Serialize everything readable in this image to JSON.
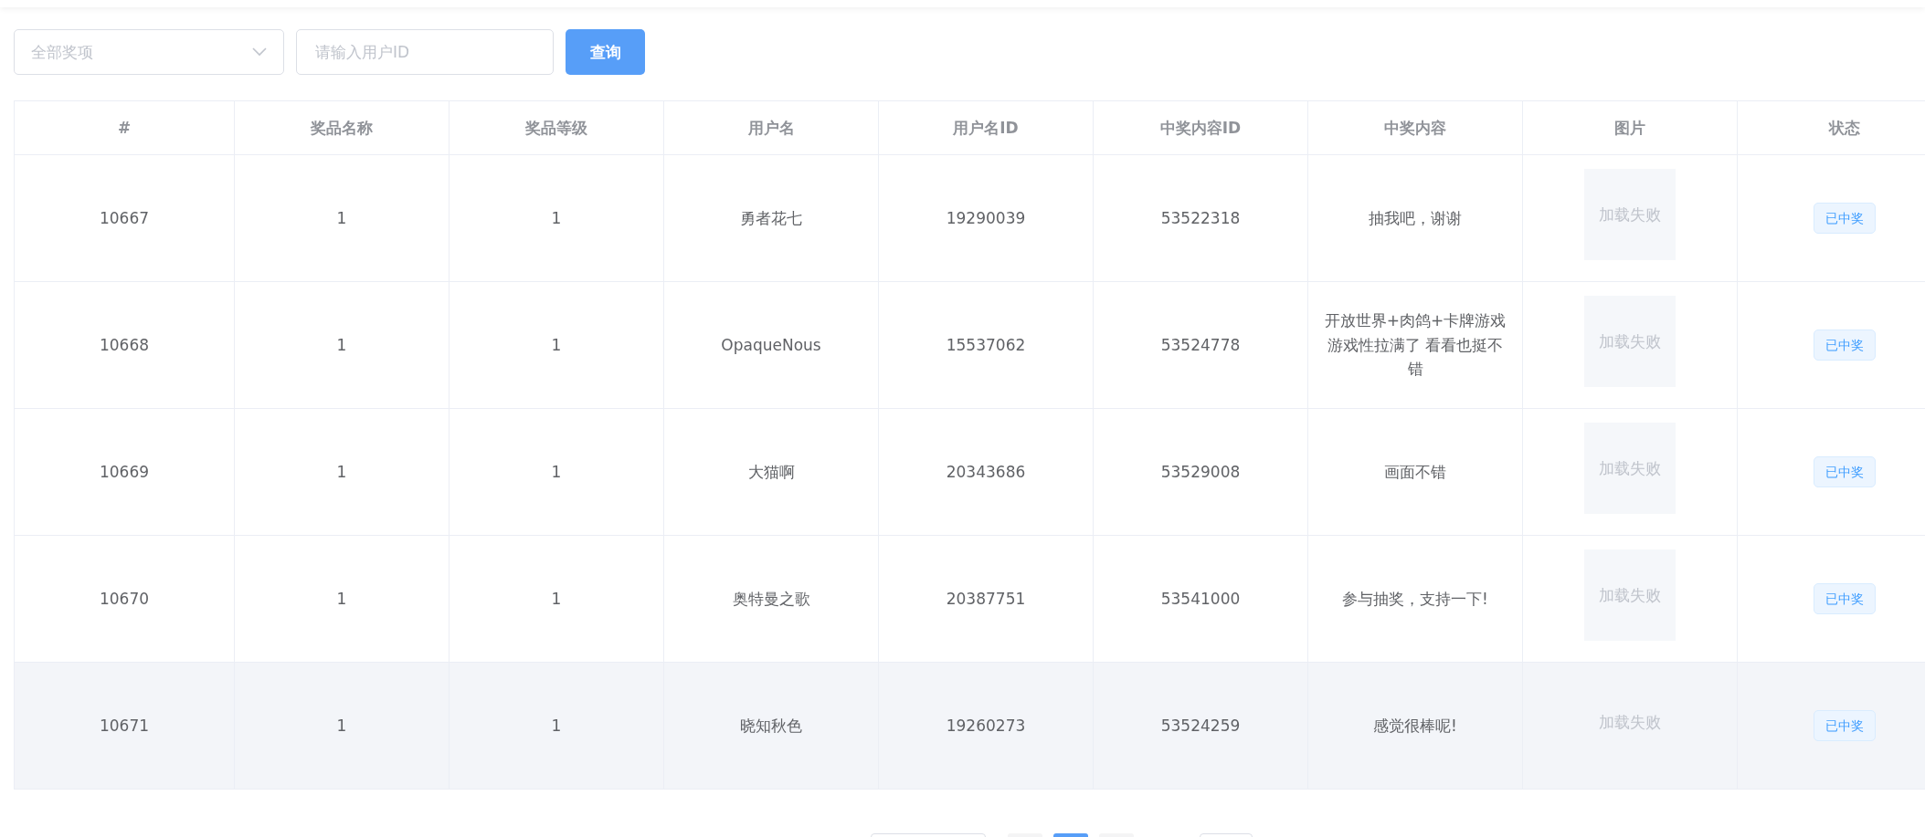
{
  "filters": {
    "prize_select": {
      "placeholder": "全部奖项"
    },
    "user_id": {
      "placeholder": "请输入用户ID"
    },
    "search_button": "查询"
  },
  "table": {
    "columns": [
      "#",
      "奖品名称",
      "奖品等级",
      "用户名",
      "用户名ID",
      "中奖内容ID",
      "中奖内容",
      "图片",
      "状态"
    ],
    "rows": [
      {
        "id": "10667",
        "prize_name": "1",
        "prize_level": "1",
        "username": "勇者花七",
        "user_id": "19290039",
        "content_id": "53522318",
        "content": "抽我吧，谢谢",
        "image": "加载失败",
        "status": "已中奖",
        "highlighted": false
      },
      {
        "id": "10668",
        "prize_name": "1",
        "prize_level": "1",
        "username": "OpaqueNous",
        "user_id": "15537062",
        "content_id": "53524778",
        "content": "开放世界+肉鸽+卡牌游戏游戏性拉满了 看看也挺不错",
        "image": "加载失败",
        "status": "已中奖",
        "highlighted": false
      },
      {
        "id": "10669",
        "prize_name": "1",
        "prize_level": "1",
        "username": "大猫啊",
        "user_id": "20343686",
        "content_id": "53529008",
        "content": "画面不错",
        "image": "加载失败",
        "status": "已中奖",
        "highlighted": false
      },
      {
        "id": "10670",
        "prize_name": "1",
        "prize_level": "1",
        "username": "奥特曼之歌",
        "user_id": "20387751",
        "content_id": "53541000",
        "content": "参与抽奖，支持一下!",
        "image": "加载失败",
        "status": "已中奖",
        "highlighted": false
      },
      {
        "id": "10671",
        "prize_name": "1",
        "prize_level": "1",
        "username": "晓知秋色",
        "user_id": "19260273",
        "content_id": "53524259",
        "content": "感觉很棒呢!",
        "image": "加载失败",
        "status": "已中奖",
        "highlighted": true
      }
    ]
  },
  "pagination": {
    "pages": [
      {
        "selected": false
      },
      {
        "selected": true
      },
      {
        "selected": false
      }
    ]
  }
}
